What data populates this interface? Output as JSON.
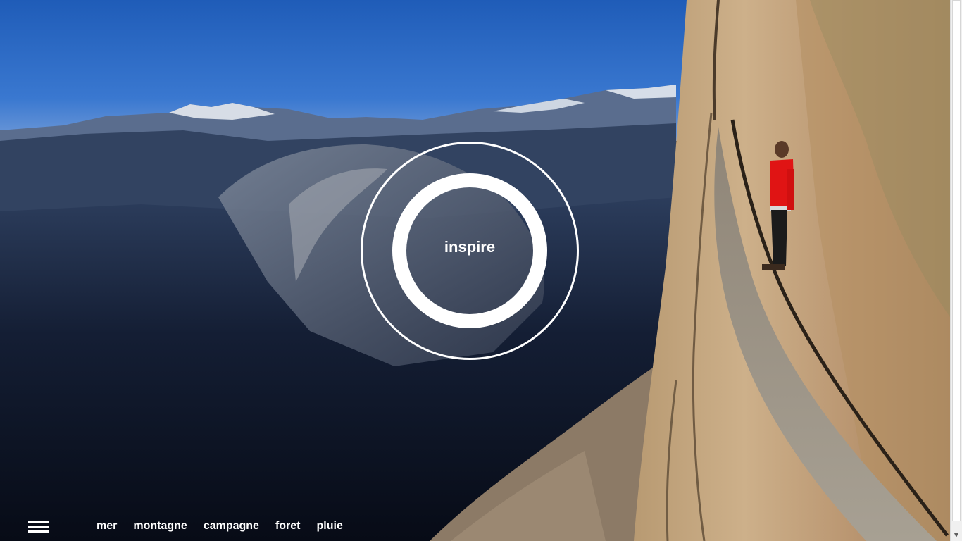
{
  "hero": {
    "center_label": "inspire"
  },
  "nav": {
    "items": [
      {
        "label": "mer"
      },
      {
        "label": "montagne"
      },
      {
        "label": "campagne"
      },
      {
        "label": "foret"
      },
      {
        "label": "pluie"
      }
    ]
  },
  "icons": {
    "menu": "hamburger-menu-icon",
    "scroll_down": "triangle-down-icon"
  },
  "colors": {
    "sky": "#2a67c4",
    "rock": "#c9a77c",
    "shirt": "#e01414",
    "text": "#ffffff"
  }
}
